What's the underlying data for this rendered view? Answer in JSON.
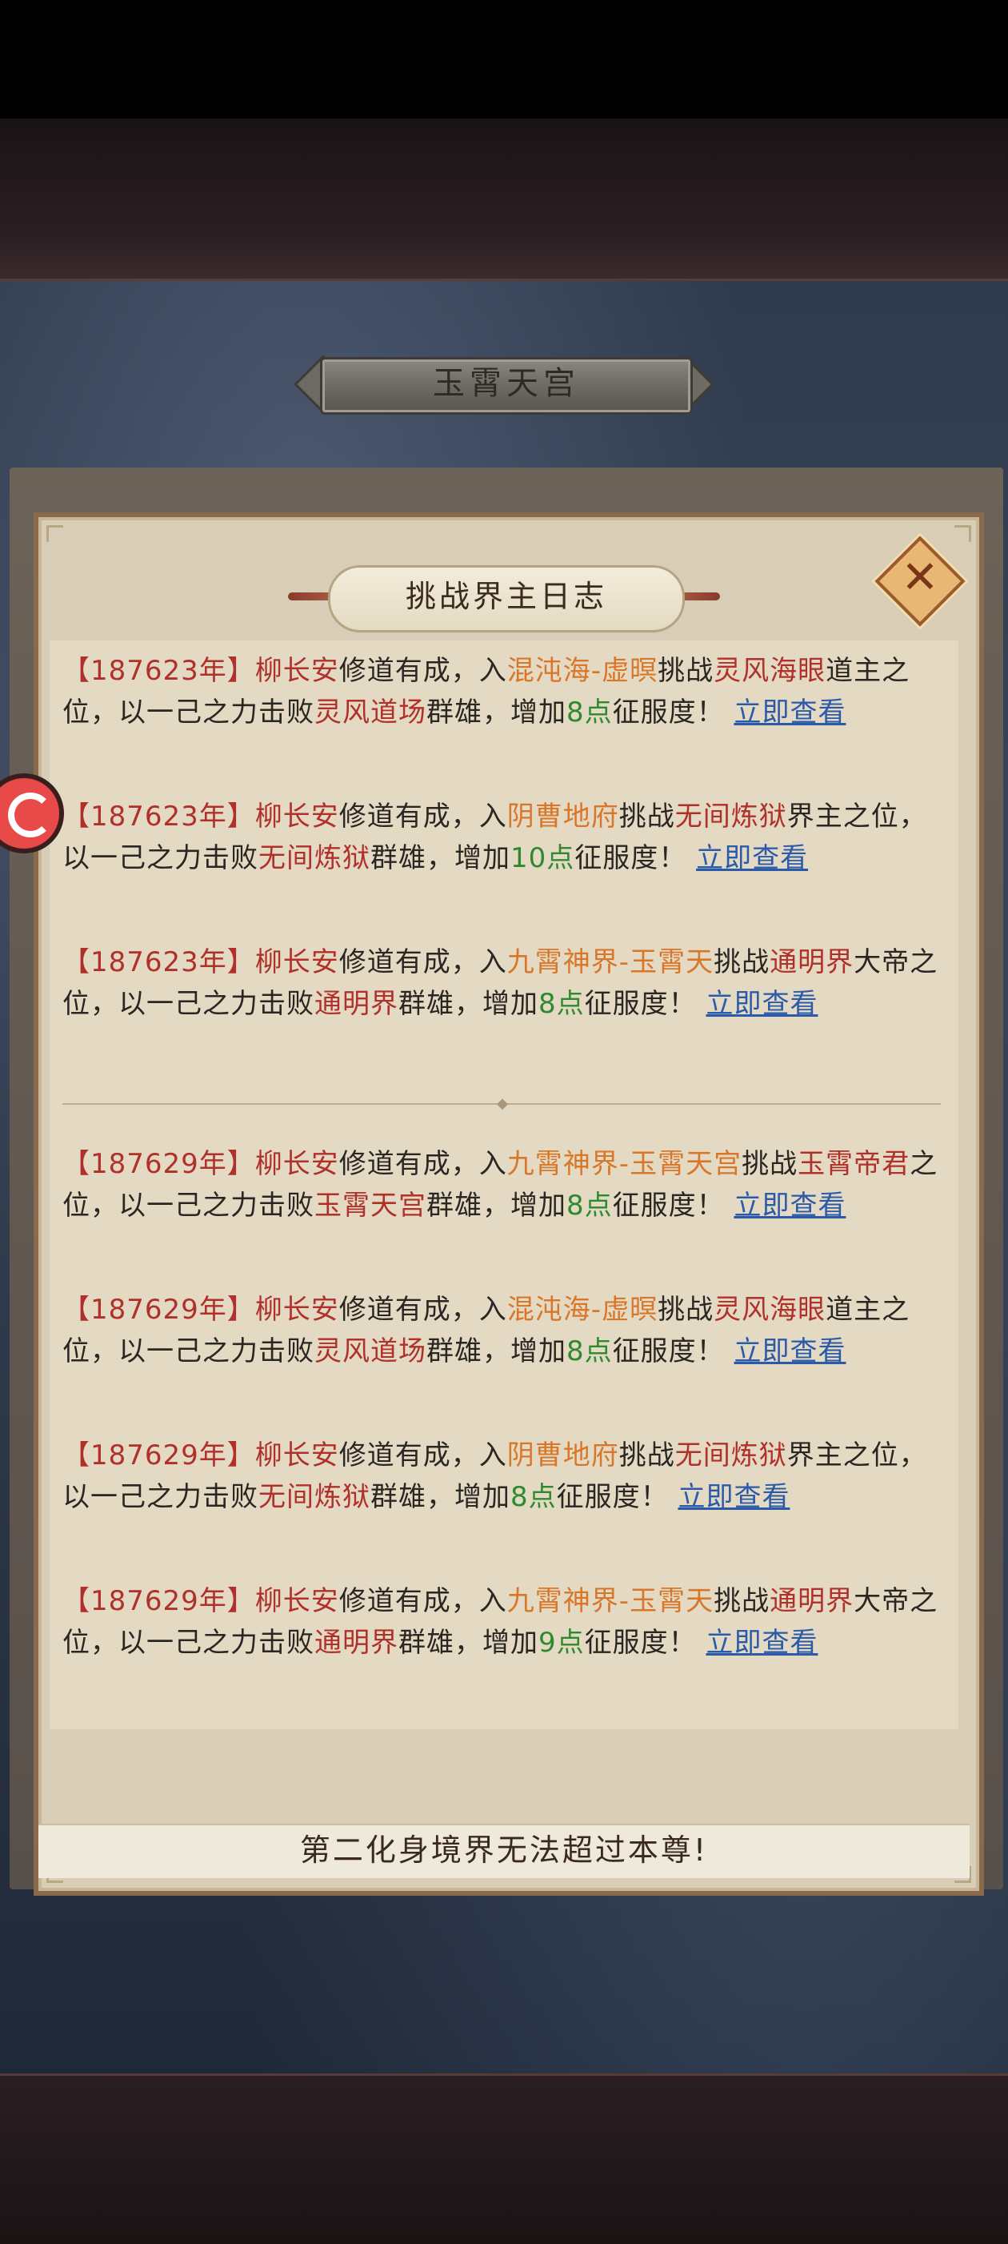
{
  "location": {
    "title": "玉霄天宫"
  },
  "dialog": {
    "title": "挑战界主日志",
    "close_icon": "close-x-icon",
    "hint": "第二化身境界无法超过本尊!"
  },
  "common": {
    "bracket_open": "【",
    "bracket_close": "】",
    "text_cultivate": "修道有成，入",
    "text_challenge": "挑战",
    "text_defeat": "，以一己之力击败",
    "text_add": "群雄，增加",
    "text_conquest": "征服度！",
    "link": "立即查看"
  },
  "entries": [
    {
      "year": "187623年",
      "name": "柳长安",
      "realm": "混沌海-虚暝",
      "target": "灵风海眼",
      "role": "道主之位",
      "defeated": "灵风道场",
      "points": "8点"
    },
    {
      "year": "187623年",
      "name": "柳长安",
      "realm": "阴曹地府",
      "target": "无间炼狱",
      "role": "界主之位",
      "defeated": "无间炼狱",
      "points": "10点"
    },
    {
      "year": "187623年",
      "name": "柳长安",
      "realm": "九霄神界-玉霄天",
      "target": "通明界",
      "role": "大帝之位",
      "defeated": "通明界",
      "points": "8点"
    },
    {
      "year": "187629年",
      "name": "柳长安",
      "realm": "九霄神界-玉霄天宫",
      "target": "玉霄帝君",
      "role": "之位",
      "defeated": "玉霄天宫",
      "points": "8点"
    },
    {
      "year": "187629年",
      "name": "柳长安",
      "realm": "混沌海-虚暝",
      "target": "灵风海眼",
      "role": "道主之位",
      "defeated": "灵风道场",
      "points": "8点"
    },
    {
      "year": "187629年",
      "name": "柳长安",
      "realm": "阴曹地府",
      "target": "无间炼狱",
      "role": "界主之位",
      "defeated": "无间炼狱",
      "points": "8点"
    },
    {
      "year": "187629年",
      "name": "柳长安",
      "realm": "九霄神界-玉霄天",
      "target": "通明界",
      "role": "大帝之位",
      "defeated": "通明界",
      "points": "9点"
    }
  ],
  "colors": {
    "highlight_red": "#b0302a",
    "highlight_orange": "#d8772a",
    "points_green": "#2f8a2f",
    "link_blue": "#2a5aa8",
    "panel_bg": "#d8ceb8"
  }
}
